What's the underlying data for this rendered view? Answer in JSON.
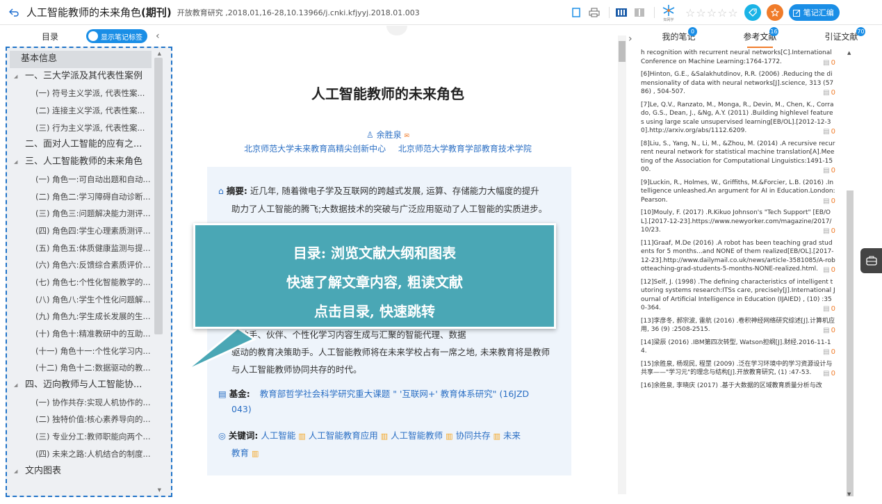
{
  "topbar": {
    "title_main": "人工智能教师的未来角色",
    "title_type": "(期刊)",
    "source": "开放教育研究 ,2018,01,16-28,10.13966/j.cnki.kfjyyj.2018.01.003",
    "note_button": "笔记汇编",
    "stars": [
      "☆",
      "☆",
      "☆",
      "☆",
      "☆"
    ],
    "logo_text": "知网学",
    "accent": "#1a8ee6"
  },
  "toc": {
    "label": "目录",
    "toggle_label": "显示笔记标签",
    "items": [
      {
        "text": "基本信息",
        "level": "hl"
      },
      {
        "text": "一、三大学派及其代表性案例",
        "level": "l1 exp"
      },
      {
        "text": "(一) 符号主义学派, 代表性案...",
        "level": "l2"
      },
      {
        "text": "(二) 连接主义学派, 代表性案...",
        "level": "l2"
      },
      {
        "text": "(三) 行为主义学派, 代表性案...",
        "level": "l2"
      },
      {
        "text": "二、面对人工智能的应有之...",
        "level": "l1"
      },
      {
        "text": "三、人工智能教师的未来角色",
        "level": "l1 exp"
      },
      {
        "text": "(一) 角色一:可自动出题和自动...",
        "level": "l2"
      },
      {
        "text": "(二) 角色二:学习障碍自动诊断...",
        "level": "l2"
      },
      {
        "text": "(三) 角色三:问题解决能力测评...",
        "level": "l2"
      },
      {
        "text": "(四) 角色四:学生心理素质测评...",
        "level": "l2"
      },
      {
        "text": "(五) 角色五:体质健康监测与提...",
        "level": "l2"
      },
      {
        "text": "(六) 角色六:反馈综合素质评价...",
        "level": "l2"
      },
      {
        "text": "(七) 角色七:个性化智能教学的...",
        "level": "l2"
      },
      {
        "text": "(八) 角色八:学生个性化问题解...",
        "level": "l2"
      },
      {
        "text": "(九) 角色九:学生成长发展的生...",
        "level": "l2"
      },
      {
        "text": "(十) 角色十:精准教研中的互助...",
        "level": "l2"
      },
      {
        "text": "(十一) 角色十一:个性化学习内...",
        "level": "l2"
      },
      {
        "text": "(十二) 角色十二:数据驱动的教...",
        "level": "l2"
      },
      {
        "text": "四、迈向教师与人工智能协...",
        "level": "l1 exp"
      },
      {
        "text": "(一) 协作共存:实现人机协作的...",
        "level": "l2"
      },
      {
        "text": "(二) 独特价值:核心素养导向的...",
        "level": "l2"
      },
      {
        "text": "(三) 专业分工:教师职能向两个...",
        "level": "l2"
      },
      {
        "text": "(四) 未来之路:人机结合的制度...",
        "level": "l2"
      },
      {
        "text": "文内图表",
        "level": "l1 exp"
      }
    ]
  },
  "article": {
    "title": "人工智能教师的未来角色",
    "author": "余胜泉",
    "inst1": "北京师范大学未来教育高精尖创新中心",
    "inst2": "北京师范大学教育学部教育技术学院",
    "abstract_label": "摘要:",
    "abstract_l1": "近几年, 随着微电子学及互联网的跨越式发展, 运算、存储能力大幅度的提升",
    "abstract_l2": "助力了人工智能的腾飞;大数据技术的突破与广泛应用驱动了人工智能的实质进步。",
    "abstract_l3": "能助手、伙伴、个性化学习内容生成与汇聚的智能代理、数据",
    "abstract_l4": "驱动的教育决策助手。人工智能教师将在未来学校占有一席之地, 未来教育将是教师",
    "abstract_l5": "与人工智能教师协同共存的时代。",
    "fund_label": "基金:",
    "fund_text": "教育部哲学社会科学研究重大课题 \" '互联网+' 教育体系研究\" (16JZD",
    "fund_text2": "043)",
    "kw_label": "关键词:",
    "keywords": [
      "人工智能",
      "人工智能教育应用",
      "人工智能教师",
      "协同共存",
      "未来"
    ],
    "keywords_cont": "教育"
  },
  "overlay": {
    "line1": "目录: 浏览文献大纲和图表",
    "line2": "快速了解文章内容, 粗读文献",
    "line3": "点击目录, 快速跳转"
  },
  "right_panel": {
    "tabs": [
      {
        "label": "我的笔记",
        "badge": "0"
      },
      {
        "label": "参考文献",
        "badge": "16"
      },
      {
        "label": "引证文献",
        "badge": "70"
      }
    ],
    "refs": [
      {
        "text": "h recognition with recurrent neural networks[C].International Conference on Machine Learning:1764-1772.",
        "count": "0"
      },
      {
        "text": "[6]Hinton, G.E., &Salakhutdinov, R.R. (2006) .Reducing the dimensionality of data with neural networks[J].science, 313 (5786) , 504-507.",
        "count": "0"
      },
      {
        "text": "[7]Le, Q.V., Ranzato, M., Monga, R., Devin, M., Chen, K., Corrado, G.S., Dean, J., &Ng, A.Y. (2011) .Building highlevel features using large scale unsupervised learning[EB/OL].[2012-12-30].http://arxiv.org/abs/1112.6209.",
        "count": "0"
      },
      {
        "text": "[8]Liu, S., Yang, N., Li, M., &Zhou, M. (2014) .A recursive recurrent neural network for statistical machine translation[A].Meeting of the Association for Computational Linguistics:1491-1500.",
        "count": "0"
      },
      {
        "text": "[9]Luckin, R., Holmes, W., Griffiths, M.&Forcier, L.B. (2016) .Intelligence unleashed.An argument for AI in Education.London:Pearson.",
        "count": "0"
      },
      {
        "text": "[10]Mouly, F. (2017) .R.Kikuo Johnson's \"Tech Support\" [EB/OL].[2017-12-23].https://www.newyorker.com/magazine/2017/10/23.",
        "count": "0"
      },
      {
        "text": "[11]Graaf, M.De (2016) .A robot has been teaching grad students for 5 months...and NONE of them realized[EB/OL].[2017-12-23].http://www.dailymail.co.uk/news/article-3581085/A-robotteaching-grad-students-5-months-NONE-realized.html.",
        "count": "0"
      },
      {
        "text": "[12]Self, J. (1998) .The defining characteristics of intelligent tutoring systems research:ITSs care, precisely[J].International Journal of Artificial Intelligence in Education (IJAIED) , (10) :350-364.",
        "count": "0"
      },
      {
        "text": "[13]李彦冬, 郝宗波, 雷航 (2016) .卷积神经网络研究综述[J].计算机应用, 36 (9) :2508-2515.",
        "count": "0"
      },
      {
        "text": "[14]梁辰 (2016) .IBM第四次转型, Watson担纲[J].财经.2016-11-14.",
        "count": "0"
      },
      {
        "text": "[15]余胜泉, 杨现民, 程罡 (2009) .泛在学习环境中的学习资源设计与共享——\"学习元\"的理念与结构[J].开放教育研究, (1) :47-53.",
        "count": "0"
      },
      {
        "text": "[16]余胜泉, 李晓庆 (2017) .基于大数据的区域教育质量分析与改",
        "count": ""
      }
    ]
  }
}
